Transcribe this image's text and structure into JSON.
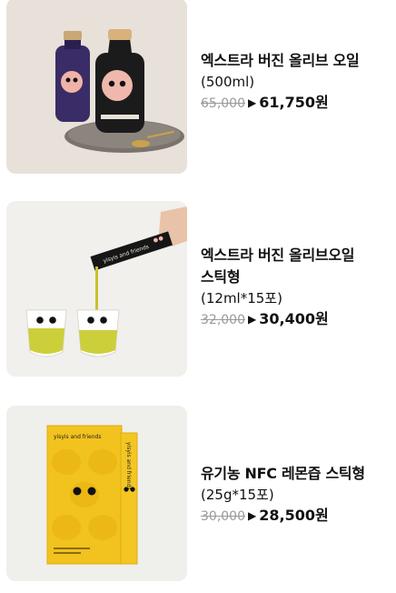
{
  "products": [
    {
      "name_lines": [
        "엑스트라 버진 올리브 오일"
      ],
      "spec": "(500ml)",
      "original_price": "65,000",
      "arrow": "▶",
      "sale_price": "61,750원",
      "colors": {
        "bg": "#e7e1da"
      }
    },
    {
      "name_lines": [
        "엑스트라 버진 올리브오일",
        "스틱형"
      ],
      "spec": "(12ml*15포)",
      "original_price": "32,000",
      "arrow": "▶",
      "sale_price": "30,400원",
      "colors": {
        "bg": "#f1f0ec"
      }
    },
    {
      "name_lines": [
        "유기농 NFC 레몬즙 스틱형"
      ],
      "spec": "(25g*15포)",
      "original_price": "30,000",
      "arrow": "▶",
      "sale_price": "28,500원",
      "colors": {
        "bg": "#efefec"
      }
    }
  ],
  "packaging_text": {
    "olive_stick": "yisyis and friends",
    "lemon_box": "yisyis and friends",
    "lemon_stick": "yisyis and friends"
  }
}
